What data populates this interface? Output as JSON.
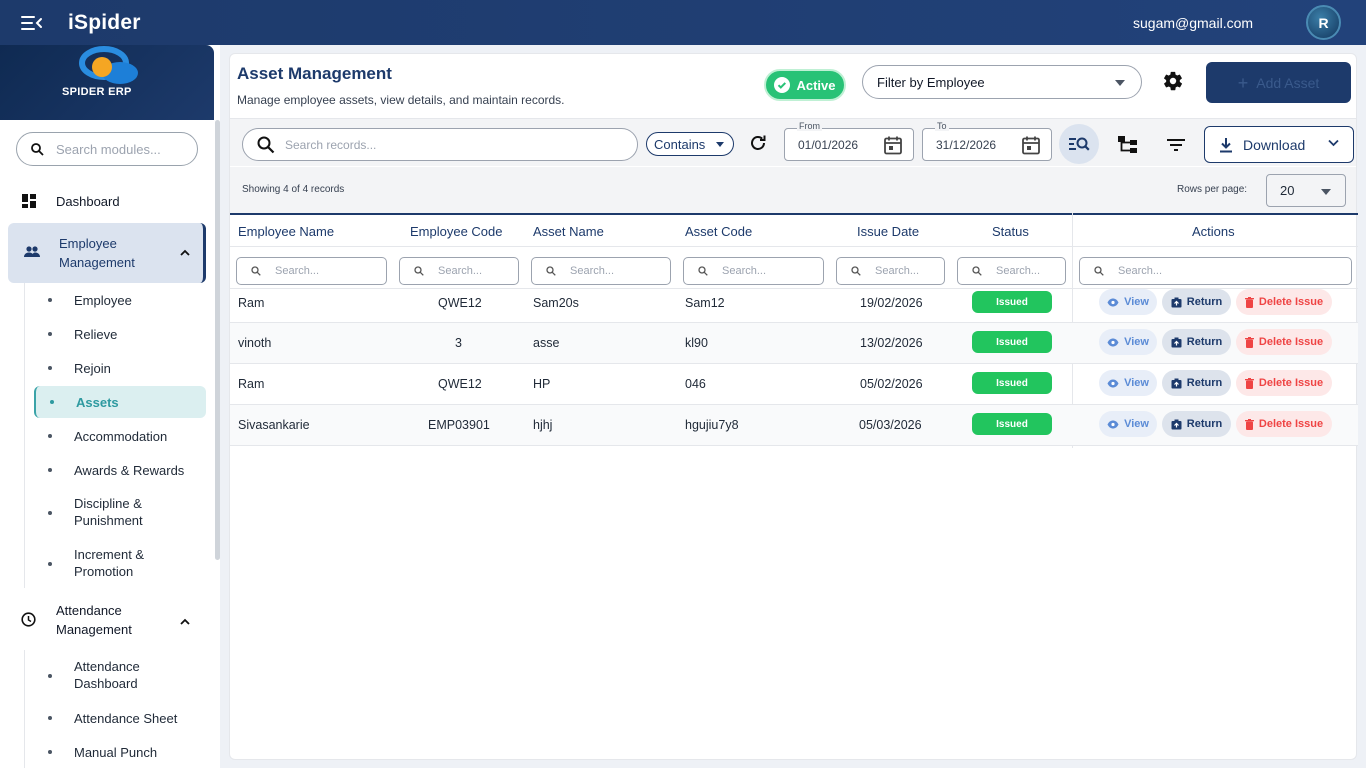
{
  "topbar": {
    "brand": "iSpider",
    "user_email": "sugam@gmail.com",
    "avatar_letter": "R"
  },
  "sidebar": {
    "logo_text": "SPIDER ERP",
    "search_placeholder": "Search modules...",
    "dashboard": "Dashboard",
    "employee_management": "Employee Management",
    "employee_items": [
      "Employee",
      "Relieve",
      "Rejoin",
      "Assets",
      "Accommodation",
      "Awards & Rewards",
      "Discipline & Punishment",
      "Increment & Promotion"
    ],
    "active_item": "Assets",
    "attendance_management": "Attendance Management",
    "attendance_items": [
      "Attendance Dashboard",
      "Attendance Sheet",
      "Manual Punch"
    ]
  },
  "header": {
    "title": "Asset Management",
    "subtitle": "Manage employee assets, view details, and maintain records.",
    "active_label": "Active",
    "filter_label": "Filter by Employee",
    "add_asset_label": "Add Asset"
  },
  "toolbar": {
    "search_placeholder": "Search records...",
    "match_mode": "Contains",
    "from_label": "From",
    "from_date": "01/01/2026",
    "to_label": "To",
    "to_date": "31/12/2026",
    "download_label": "Download"
  },
  "records": {
    "showing": "Showing 4 of 4 records",
    "rows_per_page_label": "Rows per page:",
    "rows_per_page": "20"
  },
  "table": {
    "columns": [
      "Employee Name",
      "Employee Code",
      "Asset Name",
      "Asset Code",
      "Issue Date",
      "Status",
      "Actions"
    ],
    "filter_placeholder": "Search...",
    "rows": [
      {
        "employee_name": "Ram",
        "employee_code": "QWE12",
        "asset_name": "Sam20s",
        "asset_code": "Sam12",
        "issue_date": "19/02/2026",
        "status": "Issued"
      },
      {
        "employee_name": "vinoth",
        "employee_code": "3",
        "asset_name": "asse",
        "asset_code": "kl90",
        "issue_date": "13/02/2026",
        "status": "Issued"
      },
      {
        "employee_name": "Ram",
        "employee_code": "QWE12",
        "asset_name": "HP",
        "asset_code": "046",
        "issue_date": "05/02/2026",
        "status": "Issued"
      },
      {
        "employee_name": "Sivasankarie",
        "employee_code": "EMP03901",
        "asset_name": "hjhj",
        "asset_code": "hgujiu7y8",
        "issue_date": "05/03/2026",
        "status": "Issued"
      }
    ],
    "actions": {
      "view": "View",
      "return": "Return",
      "delete": "Delete Issue"
    }
  },
  "colors": {
    "brand_navy": "#1d3a6b",
    "active_green": "#28c276",
    "status_green": "#22c55e",
    "delete_red": "#ef4444",
    "accent_teal": "#2e9aa0"
  },
  "icons": [
    "menu-collapse-icon",
    "search-icon",
    "dashboard-icon",
    "people-icon",
    "chevron-up-icon",
    "clock-icon",
    "check-circle-icon",
    "settings-icon",
    "plus-icon",
    "refresh-icon",
    "calendar-icon",
    "advanced-search-icon",
    "tree-icon",
    "filter-icon",
    "download-icon",
    "chevron-down-icon",
    "eye-icon",
    "return-icon",
    "trash-icon"
  ]
}
